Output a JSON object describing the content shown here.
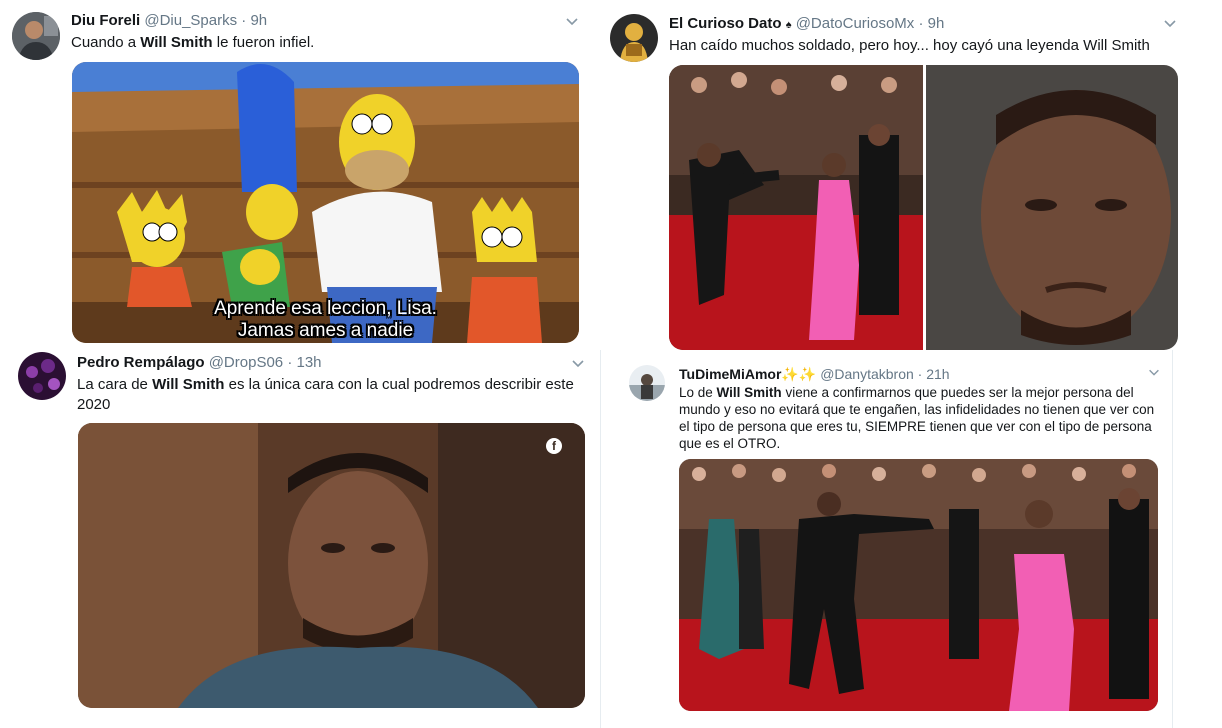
{
  "tweets": [
    {
      "name": "Diu Foreli",
      "handle": "@Diu_Sparks",
      "sep": "·",
      "time": "9h",
      "text_pre": "Cuando a ",
      "text_bold": "Will Smith",
      "text_post": " le fueron infiel.",
      "caption_line1": "Aprende esa leccion, Lisa.",
      "caption_line2": "Jamas ames a nadie"
    },
    {
      "name": "El Curioso Dato",
      "verified_glyph": "♠",
      "handle": "@DatoCuriosoMx",
      "sep": "·",
      "time": "9h",
      "text": "Han caído muchos soldado, pero hoy... hoy cayó una leyenda Will Smith"
    },
    {
      "name": "Pedro Rempálago",
      "handle": "@DropS06",
      "sep": "·",
      "time": "13h",
      "text_pre": "La cara de ",
      "text_bold": "Will Smith",
      "text_post": " es la única cara con la cual podremos describir este 2020",
      "media_badge": "f"
    },
    {
      "name": "TuDimeMiAmor",
      "name_emoji": "✨✨",
      "handle": "@Danytakbron",
      "sep": "·",
      "time": "21h",
      "text_pre": "Lo de ",
      "text_bold": "Will Smith",
      "text_post": " viene a confirmarnos que puedes ser la mejor persona del mundo y eso no evitará que te engañen, las infidelidades no tienen que ver con el tipo de persona que eres tu, SIEMPRE tienen que ver con el tipo de persona que es el OTRO."
    }
  ],
  "icons": {
    "menu": "chevron-down-icon",
    "facebook": "facebook-icon"
  },
  "colors": {
    "name": "#14171a",
    "meta": "#657786",
    "divider": "#e6ecf0",
    "red_carpet": "#b8141c",
    "pink_dress": "#f25fb4"
  }
}
